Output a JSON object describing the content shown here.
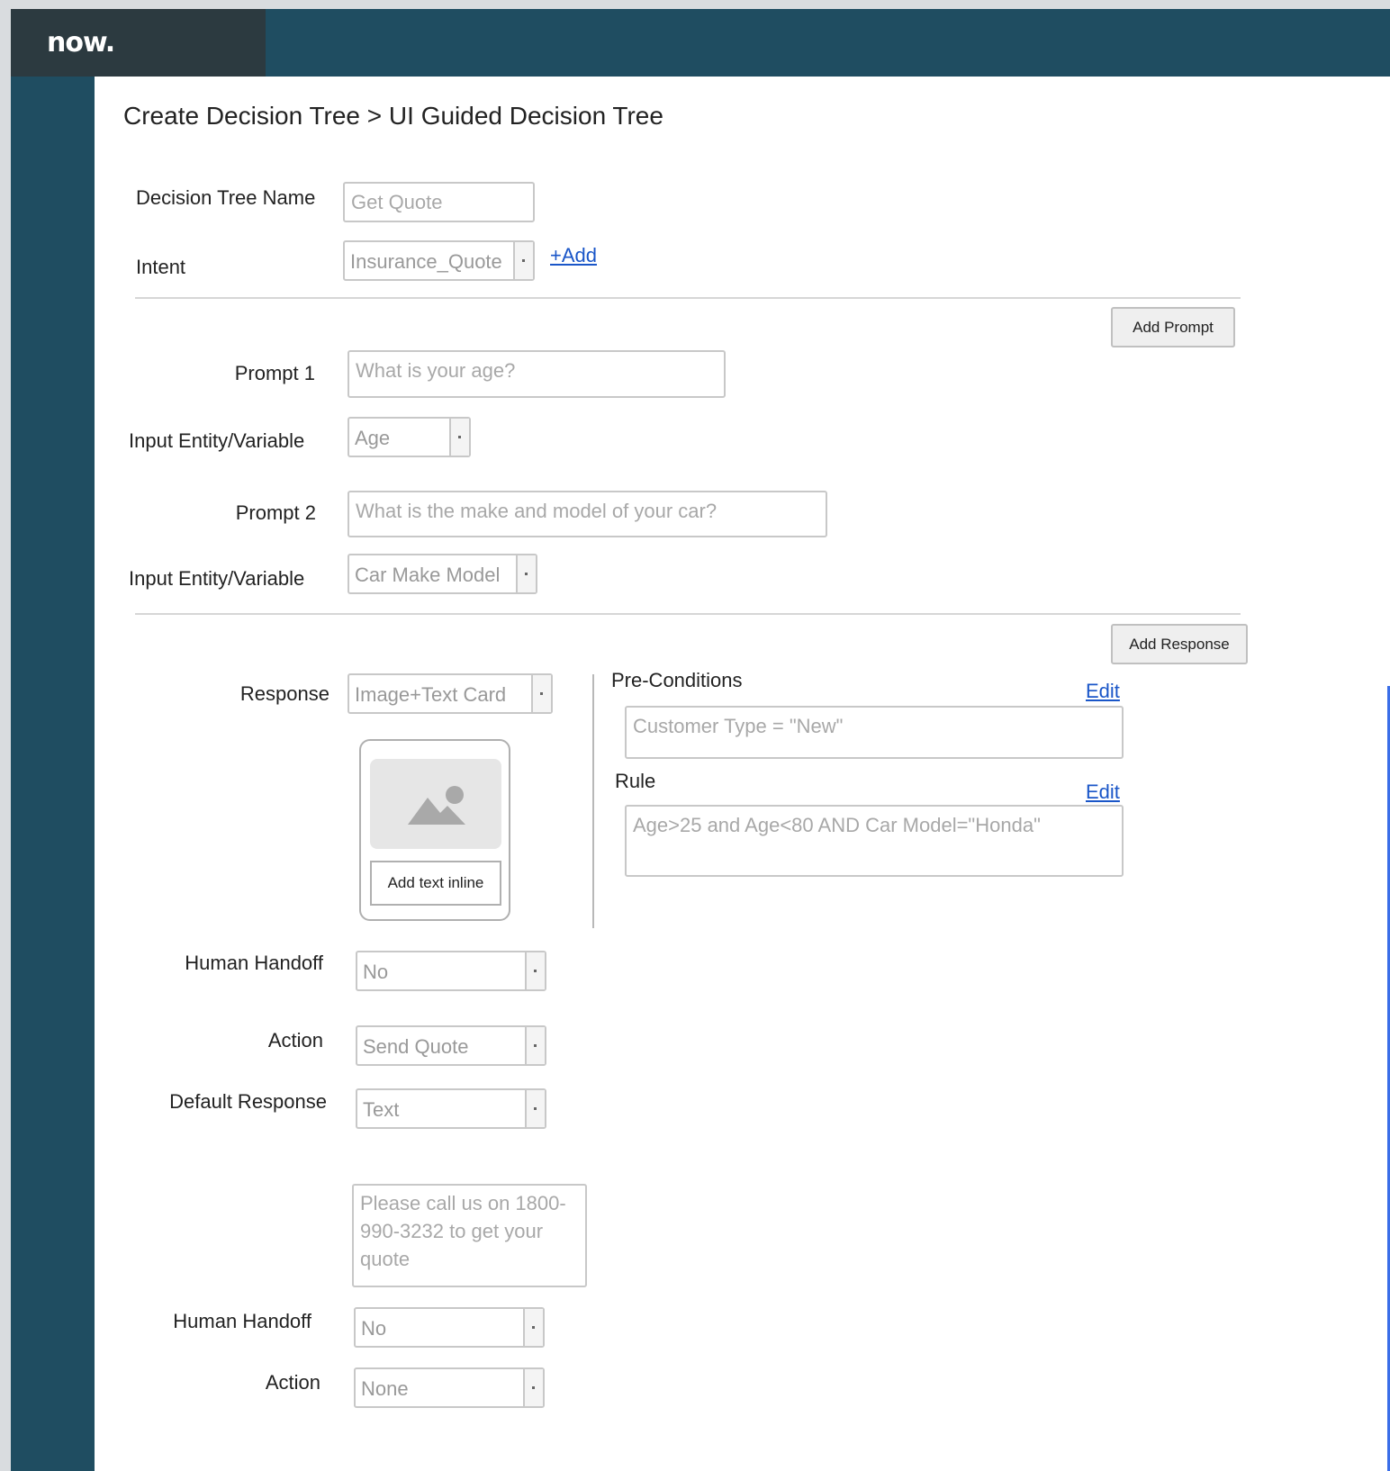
{
  "app": {
    "logo": "now."
  },
  "page": {
    "title": "Create Decision Tree > UI Guided Decision Tree"
  },
  "tree": {
    "name_label": "Decision Tree Name",
    "name_placeholder": "Get Quote",
    "intent_label": "Intent",
    "intent_value": "Insurance_Quote",
    "add_intent_link": "+Add"
  },
  "prompts": {
    "add_prompt_button": "Add Prompt",
    "items": [
      {
        "label": "Prompt 1",
        "placeholder": "What is your age?",
        "entity_label": "Input Entity/Variable",
        "entity_value": "Age"
      },
      {
        "label": "Prompt 2",
        "placeholder": "What is the make and model of your car?",
        "entity_label": "Input Entity/Variable",
        "entity_value": "Car Make Model"
      }
    ]
  },
  "response": {
    "add_response_button": "Add Response",
    "label": "Response",
    "type_value": "Image+Text Card",
    "card_button": "Add text inline",
    "preconditions_label": "Pre-Conditions",
    "preconditions_edit": "Edit",
    "preconditions_placeholder": "Customer Type = \"New\"",
    "rule_label": "Rule",
    "rule_edit": "Edit",
    "rule_placeholder": "Age>25 and Age<80 AND Car Model=\"Honda\"",
    "handoff_label": "Human Handoff",
    "handoff_value": "No",
    "action_label": "Action",
    "action_value": "Send Quote",
    "default_label": "Default Response",
    "default_value": "Text",
    "default_text_placeholder": "Please call us on 1800-990-3232 to get your quote",
    "default_handoff_label": "Human Handoff",
    "default_handoff_value": "No",
    "default_action_label": "Action",
    "default_action_value": "None"
  },
  "icons": {
    "logo": "servicenow-logo",
    "image": "image-placeholder-icon",
    "dropdown": "chevron-down-icon"
  }
}
